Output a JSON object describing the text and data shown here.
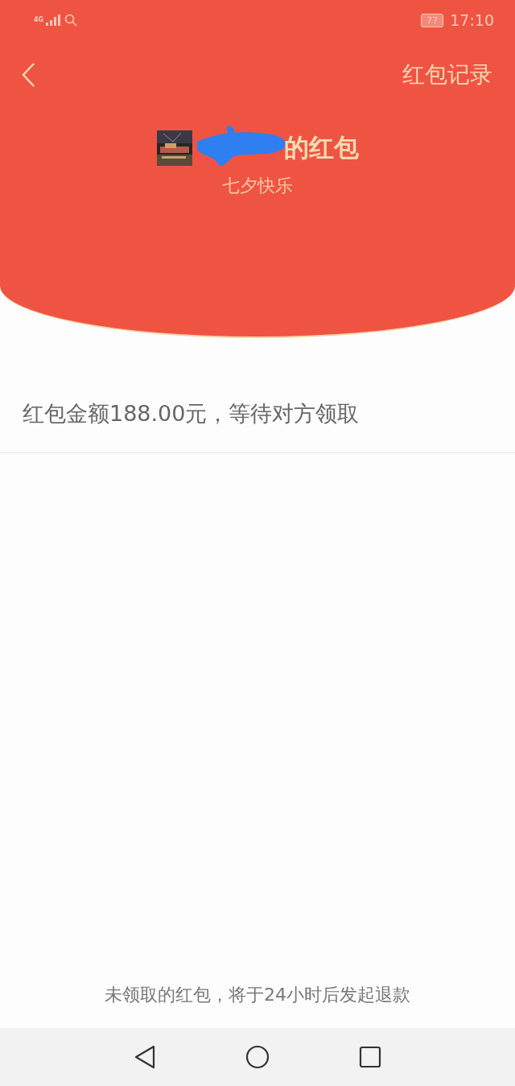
{
  "status_bar": {
    "network": "4G",
    "battery": "77",
    "time": "17:10"
  },
  "nav": {
    "right_link": "红包记录"
  },
  "header": {
    "title": "的红包",
    "subtitle": "七夕快乐"
  },
  "status_message": "红包金额188.00元，等待对方领取",
  "footer_note": "未领取的红包，将于24小时后发起退款"
}
